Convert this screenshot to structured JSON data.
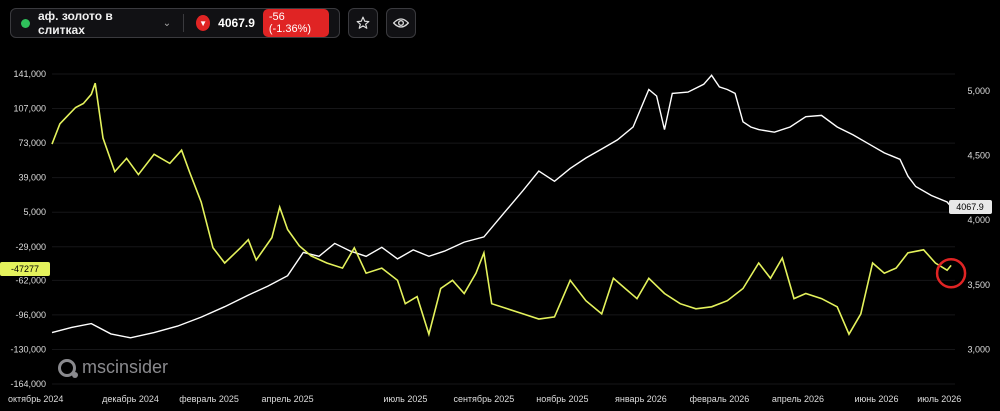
{
  "toolbar": {
    "instrument_name": "аф. золото в слитках",
    "price": "4067.9",
    "change": "-56 (-1.36%)",
    "favorite_icon": "star-icon",
    "view_icon": "eye-icon"
  },
  "watermark": {
    "text": "mscinsider"
  },
  "chart_data": {
    "type": "line",
    "left_axis": {
      "ticks": [
        141000,
        107000,
        73000,
        39000,
        5000,
        -29000,
        -62000,
        -96000,
        -130000,
        -164000
      ],
      "tick_labels": [
        "141,000",
        "107,000",
        "73,000",
        "39,000",
        "5,000",
        "-29,000",
        "-62,000",
        "-96,000",
        "-130,000",
        "-164,000"
      ],
      "range": [
        -164000,
        141000
      ]
    },
    "right_axis": {
      "ticks": [
        5000,
        4500,
        4000,
        3500,
        3000
      ],
      "tick_labels": [
        "5,000",
        "4,500",
        "4,000",
        "3,500",
        "3,000"
      ],
      "range": [
        2980,
        5130
      ]
    },
    "x_axis": {
      "tick_labels": [
        "октябрь 2024",
        "декабрь 2024",
        "февраль 2025",
        "апрель 2025",
        "июль 2025",
        "сентябрь 2025",
        "ноябрь 2025",
        "январь 2026",
        "февраль 2026",
        "апрель 2026",
        "июнь 2026",
        "июль 2026"
      ],
      "tick_positions": [
        0,
        2,
        4,
        6,
        9,
        11,
        13,
        15,
        17,
        19,
        21,
        22.6
      ],
      "range": [
        0,
        23
      ]
    },
    "last_value_labels": {
      "position": "-47277",
      "price": "4067.9"
    },
    "colors": {
      "price": "#ffffff",
      "position": "#e4f25c",
      "marker": "#e02424"
    },
    "series": [
      {
        "axis": "right",
        "values": [
          [
            0.0,
            3130
          ],
          [
            0.5,
            3170
          ],
          [
            1.0,
            3200
          ],
          [
            1.5,
            3120
          ],
          [
            2.0,
            3090
          ],
          [
            2.6,
            3130
          ],
          [
            3.2,
            3180
          ],
          [
            3.8,
            3250
          ],
          [
            4.4,
            3330
          ],
          [
            5.0,
            3420
          ],
          [
            5.5,
            3490
          ],
          [
            6.0,
            3570
          ],
          [
            6.4,
            3750
          ],
          [
            6.8,
            3720
          ],
          [
            7.2,
            3820
          ],
          [
            7.6,
            3760
          ],
          [
            8.0,
            3720
          ],
          [
            8.4,
            3790
          ],
          [
            8.8,
            3700
          ],
          [
            9.2,
            3770
          ],
          [
            9.6,
            3720
          ],
          [
            10.0,
            3760
          ],
          [
            10.5,
            3830
          ],
          [
            11.0,
            3870
          ],
          [
            11.5,
            4050
          ],
          [
            12.0,
            4230
          ],
          [
            12.4,
            4380
          ],
          [
            12.8,
            4300
          ],
          [
            13.2,
            4400
          ],
          [
            13.6,
            4480
          ],
          [
            14.0,
            4550
          ],
          [
            14.4,
            4620
          ],
          [
            14.8,
            4720
          ],
          [
            15.2,
            5010
          ],
          [
            15.4,
            4960
          ],
          [
            15.6,
            4700
          ],
          [
            15.8,
            4980
          ],
          [
            16.2,
            4990
          ],
          [
            16.6,
            5050
          ],
          [
            16.8,
            5120
          ],
          [
            17.0,
            5030
          ],
          [
            17.2,
            5010
          ],
          [
            17.4,
            4980
          ],
          [
            17.6,
            4760
          ],
          [
            17.8,
            4720
          ],
          [
            18.0,
            4700
          ],
          [
            18.4,
            4680
          ],
          [
            18.8,
            4720
          ],
          [
            19.2,
            4800
          ],
          [
            19.6,
            4810
          ],
          [
            20.0,
            4720
          ],
          [
            20.4,
            4660
          ],
          [
            20.8,
            4590
          ],
          [
            21.2,
            4520
          ],
          [
            21.6,
            4470
          ],
          [
            21.8,
            4340
          ],
          [
            22.0,
            4260
          ],
          [
            22.4,
            4190
          ],
          [
            22.8,
            4140
          ],
          [
            23.0,
            4068
          ]
        ]
      },
      {
        "axis": "left",
        "values": [
          [
            0.0,
            72000
          ],
          [
            0.2,
            92000
          ],
          [
            0.4,
            100000
          ],
          [
            0.6,
            108000
          ],
          [
            0.8,
            112000
          ],
          [
            1.0,
            121000
          ],
          [
            1.1,
            132000
          ],
          [
            1.3,
            78000
          ],
          [
            1.6,
            45000
          ],
          [
            1.9,
            58000
          ],
          [
            2.2,
            42000
          ],
          [
            2.6,
            62000
          ],
          [
            3.0,
            53000
          ],
          [
            3.3,
            66000
          ],
          [
            3.5,
            45000
          ],
          [
            3.8,
            15000
          ],
          [
            4.1,
            -30000
          ],
          [
            4.4,
            -45000
          ],
          [
            4.8,
            -30000
          ],
          [
            5.0,
            -22000
          ],
          [
            5.2,
            -42000
          ],
          [
            5.6,
            -20000
          ],
          [
            5.8,
            10000
          ],
          [
            6.0,
            -12000
          ],
          [
            6.3,
            -28000
          ],
          [
            6.6,
            -38000
          ],
          [
            7.0,
            -45000
          ],
          [
            7.4,
            -50000
          ],
          [
            7.7,
            -30000
          ],
          [
            8.0,
            -55000
          ],
          [
            8.4,
            -50000
          ],
          [
            8.8,
            -62000
          ],
          [
            9.0,
            -85000
          ],
          [
            9.3,
            -78000
          ],
          [
            9.6,
            -115000
          ],
          [
            9.9,
            -70000
          ],
          [
            10.2,
            -62000
          ],
          [
            10.5,
            -75000
          ],
          [
            10.8,
            -55000
          ],
          [
            11.0,
            -35000
          ],
          [
            11.2,
            -85000
          ],
          [
            11.6,
            -90000
          ],
          [
            12.0,
            -95000
          ],
          [
            12.4,
            -100000
          ],
          [
            12.8,
            -98000
          ],
          [
            13.2,
            -62000
          ],
          [
            13.6,
            -82000
          ],
          [
            14.0,
            -95000
          ],
          [
            14.3,
            -60000
          ],
          [
            14.6,
            -70000
          ],
          [
            14.9,
            -80000
          ],
          [
            15.2,
            -60000
          ],
          [
            15.6,
            -75000
          ],
          [
            16.0,
            -85000
          ],
          [
            16.4,
            -90000
          ],
          [
            16.8,
            -88000
          ],
          [
            17.2,
            -82000
          ],
          [
            17.6,
            -70000
          ],
          [
            18.0,
            -45000
          ],
          [
            18.3,
            -60000
          ],
          [
            18.6,
            -40000
          ],
          [
            18.9,
            -80000
          ],
          [
            19.2,
            -75000
          ],
          [
            19.6,
            -80000
          ],
          [
            20.0,
            -88000
          ],
          [
            20.3,
            -115000
          ],
          [
            20.6,
            -95000
          ],
          [
            20.9,
            -45000
          ],
          [
            21.2,
            -55000
          ],
          [
            21.5,
            -50000
          ],
          [
            21.8,
            -35000
          ],
          [
            22.2,
            -32000
          ],
          [
            22.5,
            -45000
          ],
          [
            22.8,
            -52000
          ],
          [
            22.9,
            -47277
          ]
        ]
      }
    ],
    "marker": {
      "x": 22.9,
      "y": -55000,
      "axis": "left"
    }
  }
}
